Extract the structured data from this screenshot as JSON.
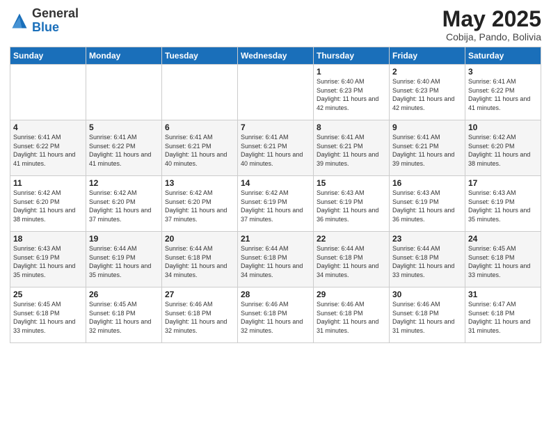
{
  "logo": {
    "general": "General",
    "blue": "Blue"
  },
  "title": "May 2025",
  "subtitle": "Cobija, Pando, Bolivia",
  "days_of_week": [
    "Sunday",
    "Monday",
    "Tuesday",
    "Wednesday",
    "Thursday",
    "Friday",
    "Saturday"
  ],
  "weeks": [
    [
      {
        "day": "",
        "info": ""
      },
      {
        "day": "",
        "info": ""
      },
      {
        "day": "",
        "info": ""
      },
      {
        "day": "",
        "info": ""
      },
      {
        "day": "1",
        "info": "Sunrise: 6:40 AM\nSunset: 6:23 PM\nDaylight: 11 hours and 42 minutes."
      },
      {
        "day": "2",
        "info": "Sunrise: 6:40 AM\nSunset: 6:23 PM\nDaylight: 11 hours and 42 minutes."
      },
      {
        "day": "3",
        "info": "Sunrise: 6:41 AM\nSunset: 6:22 PM\nDaylight: 11 hours and 41 minutes."
      }
    ],
    [
      {
        "day": "4",
        "info": "Sunrise: 6:41 AM\nSunset: 6:22 PM\nDaylight: 11 hours and 41 minutes."
      },
      {
        "day": "5",
        "info": "Sunrise: 6:41 AM\nSunset: 6:22 PM\nDaylight: 11 hours and 41 minutes."
      },
      {
        "day": "6",
        "info": "Sunrise: 6:41 AM\nSunset: 6:21 PM\nDaylight: 11 hours and 40 minutes."
      },
      {
        "day": "7",
        "info": "Sunrise: 6:41 AM\nSunset: 6:21 PM\nDaylight: 11 hours and 40 minutes."
      },
      {
        "day": "8",
        "info": "Sunrise: 6:41 AM\nSunset: 6:21 PM\nDaylight: 11 hours and 39 minutes."
      },
      {
        "day": "9",
        "info": "Sunrise: 6:41 AM\nSunset: 6:21 PM\nDaylight: 11 hours and 39 minutes."
      },
      {
        "day": "10",
        "info": "Sunrise: 6:42 AM\nSunset: 6:20 PM\nDaylight: 11 hours and 38 minutes."
      }
    ],
    [
      {
        "day": "11",
        "info": "Sunrise: 6:42 AM\nSunset: 6:20 PM\nDaylight: 11 hours and 38 minutes."
      },
      {
        "day": "12",
        "info": "Sunrise: 6:42 AM\nSunset: 6:20 PM\nDaylight: 11 hours and 37 minutes."
      },
      {
        "day": "13",
        "info": "Sunrise: 6:42 AM\nSunset: 6:20 PM\nDaylight: 11 hours and 37 minutes."
      },
      {
        "day": "14",
        "info": "Sunrise: 6:42 AM\nSunset: 6:19 PM\nDaylight: 11 hours and 37 minutes."
      },
      {
        "day": "15",
        "info": "Sunrise: 6:43 AM\nSunset: 6:19 PM\nDaylight: 11 hours and 36 minutes."
      },
      {
        "day": "16",
        "info": "Sunrise: 6:43 AM\nSunset: 6:19 PM\nDaylight: 11 hours and 36 minutes."
      },
      {
        "day": "17",
        "info": "Sunrise: 6:43 AM\nSunset: 6:19 PM\nDaylight: 11 hours and 35 minutes."
      }
    ],
    [
      {
        "day": "18",
        "info": "Sunrise: 6:43 AM\nSunset: 6:19 PM\nDaylight: 11 hours and 35 minutes."
      },
      {
        "day": "19",
        "info": "Sunrise: 6:44 AM\nSunset: 6:19 PM\nDaylight: 11 hours and 35 minutes."
      },
      {
        "day": "20",
        "info": "Sunrise: 6:44 AM\nSunset: 6:18 PM\nDaylight: 11 hours and 34 minutes."
      },
      {
        "day": "21",
        "info": "Sunrise: 6:44 AM\nSunset: 6:18 PM\nDaylight: 11 hours and 34 minutes."
      },
      {
        "day": "22",
        "info": "Sunrise: 6:44 AM\nSunset: 6:18 PM\nDaylight: 11 hours and 34 minutes."
      },
      {
        "day": "23",
        "info": "Sunrise: 6:44 AM\nSunset: 6:18 PM\nDaylight: 11 hours and 33 minutes."
      },
      {
        "day": "24",
        "info": "Sunrise: 6:45 AM\nSunset: 6:18 PM\nDaylight: 11 hours and 33 minutes."
      }
    ],
    [
      {
        "day": "25",
        "info": "Sunrise: 6:45 AM\nSunset: 6:18 PM\nDaylight: 11 hours and 33 minutes."
      },
      {
        "day": "26",
        "info": "Sunrise: 6:45 AM\nSunset: 6:18 PM\nDaylight: 11 hours and 32 minutes."
      },
      {
        "day": "27",
        "info": "Sunrise: 6:46 AM\nSunset: 6:18 PM\nDaylight: 11 hours and 32 minutes."
      },
      {
        "day": "28",
        "info": "Sunrise: 6:46 AM\nSunset: 6:18 PM\nDaylight: 11 hours and 32 minutes."
      },
      {
        "day": "29",
        "info": "Sunrise: 6:46 AM\nSunset: 6:18 PM\nDaylight: 11 hours and 31 minutes."
      },
      {
        "day": "30",
        "info": "Sunrise: 6:46 AM\nSunset: 6:18 PM\nDaylight: 11 hours and 31 minutes."
      },
      {
        "day": "31",
        "info": "Sunrise: 6:47 AM\nSunset: 6:18 PM\nDaylight: 11 hours and 31 minutes."
      }
    ]
  ]
}
